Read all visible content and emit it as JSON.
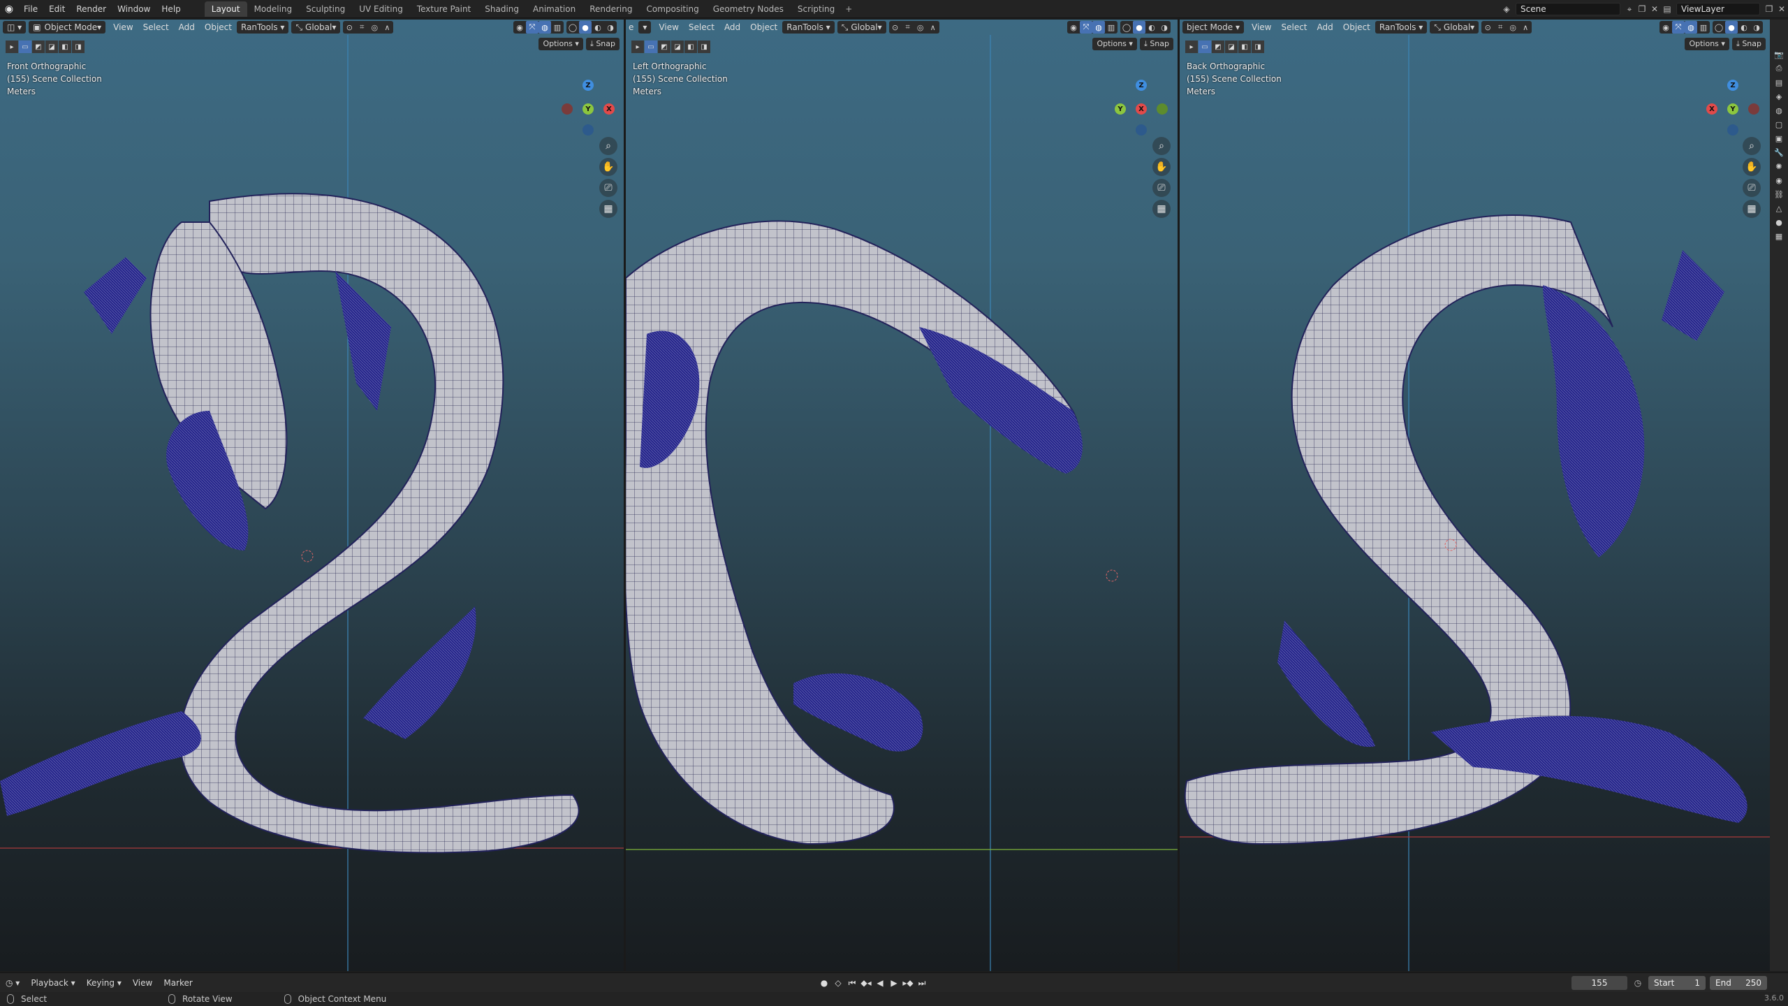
{
  "topbar": {
    "menus": [
      "File",
      "Edit",
      "Render",
      "Window",
      "Help"
    ],
    "workspaces": [
      "Layout",
      "Modeling",
      "Sculpting",
      "UV Editing",
      "Texture Paint",
      "Shading",
      "Animation",
      "Rendering",
      "Compositing",
      "Geometry Nodes",
      "Scripting"
    ],
    "active_workspace": "Layout",
    "scene": "Scene",
    "view_layer": "ViewLayer"
  },
  "viewport_header": {
    "mode": "Object Mode",
    "menus": [
      "View",
      "Select",
      "Add",
      "Object",
      "RanTools"
    ],
    "orientation": "Global",
    "options": "Options",
    "snap": "Snap"
  },
  "viewports": [
    {
      "view": "Front Orthographic",
      "collection": "(155) Scene Collection",
      "units": "Meters"
    },
    {
      "view": "Left Orthographic",
      "collection": "(155) Scene Collection",
      "units": "Meters"
    },
    {
      "view": "Back Orthographic",
      "collection": "(155) Scene Collection",
      "units": "Meters"
    }
  ],
  "viewport3_mode_partial": "bject Mode",
  "viewport2_mode_partial": "e",
  "gizmo": {
    "front": [
      "Z",
      "Y",
      "X"
    ],
    "left": [
      "Z",
      "Y",
      "X"
    ],
    "back": [
      "Z",
      "X",
      "Y"
    ]
  },
  "timeline": {
    "menus": [
      "Playback",
      "Keying",
      "View",
      "Marker"
    ],
    "current_frame": "155",
    "start_label": "Start",
    "start": "1",
    "end_label": "End",
    "end": "250"
  },
  "statusbar": {
    "select": "Select",
    "rotate": "Rotate View",
    "context": "Object Context Menu",
    "version": "3.6.0"
  },
  "colors": {
    "axis_x": "#e24a4a",
    "axis_y": "#8cc63f",
    "axis_z": "#3f8ee0",
    "active": "#4772b3",
    "mesh_wire": "#1e1e8c",
    "mesh_surface": "#c9c9cf"
  }
}
